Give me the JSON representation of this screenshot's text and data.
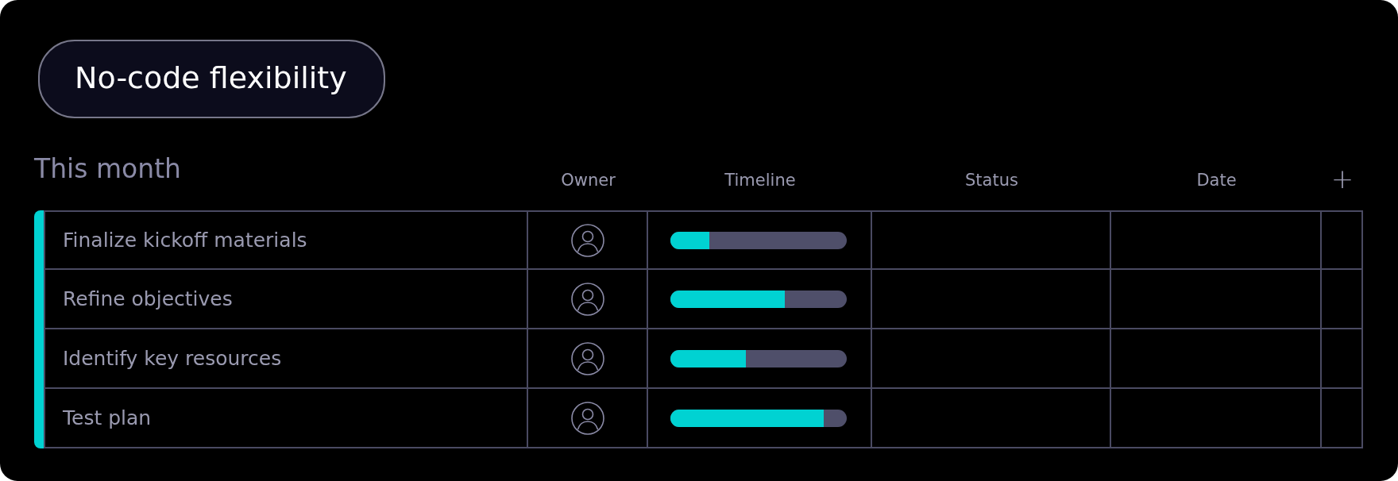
{
  "badge": {
    "label": "No-code flexibility"
  },
  "group": {
    "title": "This month",
    "color": "#00d2d2"
  },
  "table": {
    "columns": [
      "Owner",
      "Timeline",
      "Status",
      "Date"
    ],
    "add_label": "+",
    "rows": [
      {
        "name": "Finalize kickoff materials",
        "level": 0.22
      },
      {
        "name": "Refine objectives",
        "level": 0.65
      },
      {
        "name": "Identify key resources",
        "level": 0.43
      },
      {
        "name": "Test plan",
        "level": 0.87
      }
    ]
  }
}
